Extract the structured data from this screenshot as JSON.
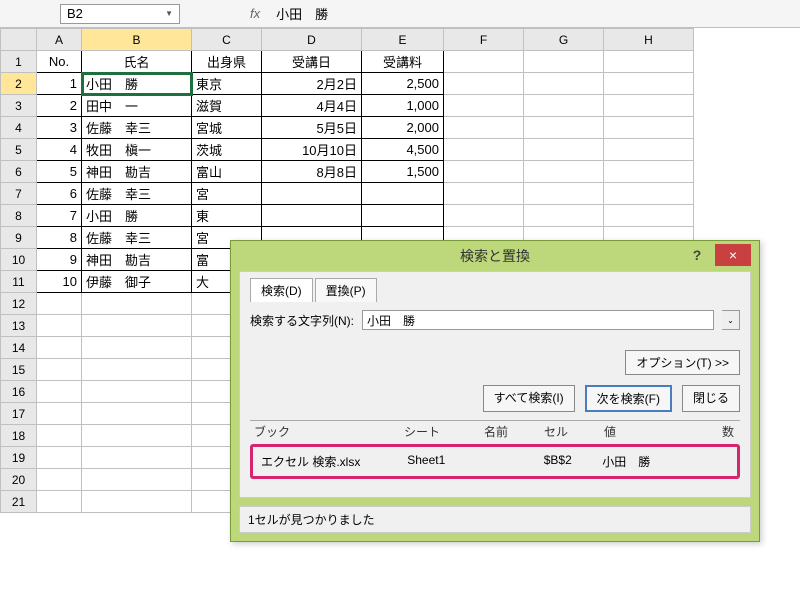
{
  "formula_bar": {
    "cell_ref": "B2",
    "fx_label": "fx",
    "value": "小田　勝"
  },
  "columns": [
    "A",
    "B",
    "C",
    "D",
    "E",
    "F",
    "G",
    "H"
  ],
  "headers": {
    "no": "No.",
    "name": "氏名",
    "pref": "出身県",
    "date": "受講日",
    "fee": "受講料"
  },
  "rows": [
    {
      "no": "1",
      "name": "小田　勝",
      "pref": "東京",
      "date": "2月2日",
      "fee": "2,500"
    },
    {
      "no": "2",
      "name": "田中　一",
      "pref": "滋賀",
      "date": "4月4日",
      "fee": "1,000"
    },
    {
      "no": "3",
      "name": "佐藤　幸三",
      "pref": "宮城",
      "date": "5月5日",
      "fee": "2,000"
    },
    {
      "no": "4",
      "name": "牧田　槇一",
      "pref": "茨城",
      "date": "10月10日",
      "fee": "4,500"
    },
    {
      "no": "5",
      "name": "神田　勘吉",
      "pref": "富山",
      "date": "8月8日",
      "fee": "1,500"
    },
    {
      "no": "6",
      "name": "佐藤　幸三",
      "pref": "宮",
      "date": "",
      "fee": ""
    },
    {
      "no": "7",
      "name": "小田　勝",
      "pref": "東",
      "date": "",
      "fee": ""
    },
    {
      "no": "8",
      "name": "佐藤　幸三",
      "pref": "宮",
      "date": "",
      "fee": ""
    },
    {
      "no": "9",
      "name": "神田　勘吉",
      "pref": "富",
      "date": "",
      "fee": ""
    },
    {
      "no": "10",
      "name": "伊藤　御子",
      "pref": "大",
      "date": "",
      "fee": ""
    }
  ],
  "row_numbers": [
    "1",
    "2",
    "3",
    "4",
    "5",
    "6",
    "7",
    "8",
    "9",
    "10",
    "11",
    "12",
    "13",
    "14",
    "15",
    "16",
    "17",
    "18",
    "19",
    "20",
    "21"
  ],
  "dialog": {
    "title": "検索と置換",
    "help": "?",
    "close": "×",
    "tab_find": "検索(D)",
    "tab_replace": "置換(P)",
    "find_label": "検索する文字列(N):",
    "find_value": "小田　勝",
    "options": "オプション(T) >>",
    "find_all": "すべて検索(I)",
    "find_next": "次を検索(F)",
    "close_btn": "閉じる",
    "cols": {
      "book": "ブック",
      "sheet": "シート",
      "name": "名前",
      "cell": "セル",
      "value": "値",
      "num": "数"
    },
    "result": {
      "book": "エクセル 検索.xlsx",
      "sheet": "Sheet1",
      "name": "",
      "cell": "$B$2",
      "value": "小田　勝",
      "num": ""
    },
    "status": "1セルが見つかりました"
  }
}
